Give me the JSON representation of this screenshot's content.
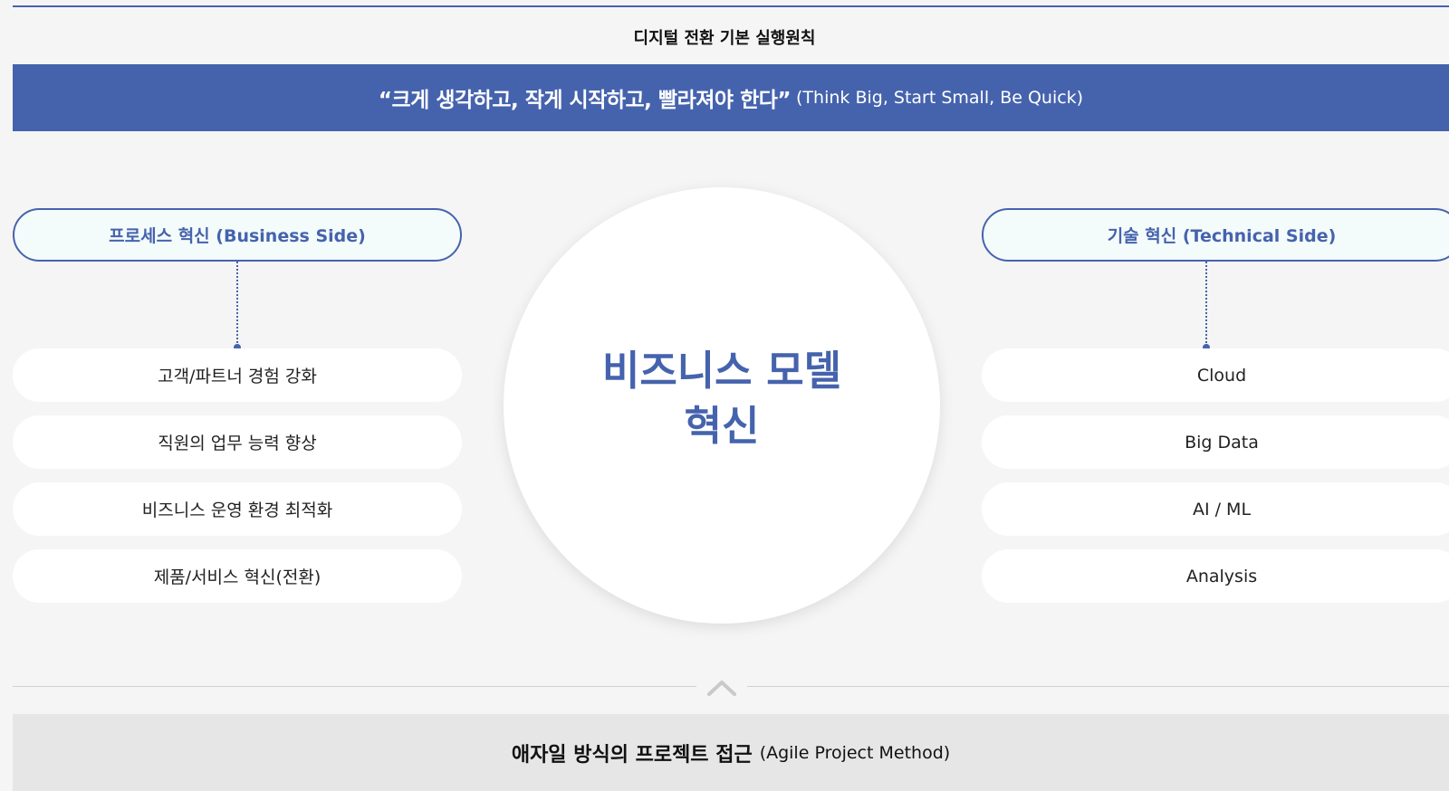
{
  "title": "디지털 전환 기본 실행원칙",
  "banner": {
    "quote": "“크게 생각하고, 작게 시작하고, 빨라져야 한다”",
    "subtitle": "(Think Big, Start Small, Be Quick)"
  },
  "left": {
    "header": "프로세스 혁신 (Business Side)",
    "items": [
      "고객/파트너 경험 강화",
      "직원의 업무 능력 향상",
      "비즈니스 운영 환경 최적화",
      "제품/서비스 혁신(전환)"
    ]
  },
  "center": {
    "line1": "비즈니스 모델",
    "line2": "혁신"
  },
  "right": {
    "header": "기술 혁신 (Technical Side)",
    "items": [
      "Cloud",
      "Big Data",
      "AI / ML",
      "Analysis"
    ]
  },
  "bottom": {
    "main": "애자일 방식의 프로젝트 접근",
    "sub": "(Agile Project Method)"
  },
  "icons": {
    "divider_chevron": "chevron-up-icon"
  },
  "colors": {
    "accent": "#4563ad",
    "background": "#f5f5f5",
    "bottom_bar": "#e6e6e6"
  }
}
